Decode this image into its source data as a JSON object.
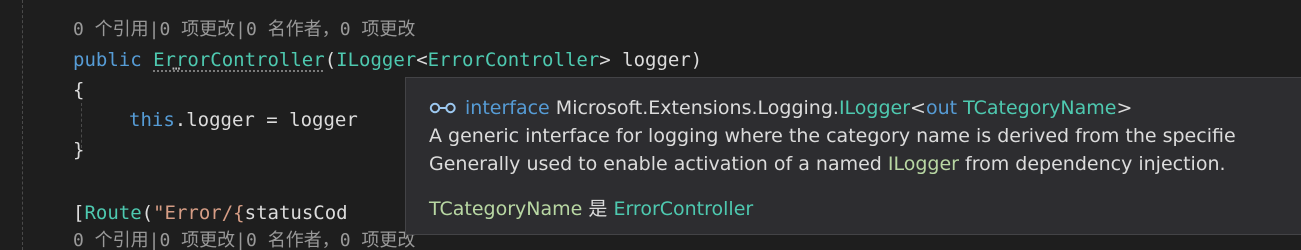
{
  "editor": {
    "codelens_top": "0 个引用|0 项更改|0 名作者，0 项更改",
    "constructor_line": {
      "kw_public": "public",
      "ctor_name": "ErrorController",
      "open_paren": "(",
      "param_type": "ILogger",
      "lt": "<",
      "param_type_arg": "ErrorController",
      "gt": ">",
      "param_name": " logger)"
    },
    "open_brace": "{",
    "assign_line": {
      "kw_this": "this",
      "rest": ".logger = logger"
    },
    "close_brace": "}",
    "route_line": {
      "open": "[",
      "attr": "Route",
      "paren": "(",
      "string": "\"Error/{",
      "rest": "statusCod"
    },
    "codelens_bottom": "0 个引用|0 项更改|0 名作者，0 项更改",
    "dots_glyph": "⋯"
  },
  "tooltip": {
    "kind": "interface",
    "namespace": "Microsoft.Extensions.Logging.",
    "type_name": "ILogger",
    "lt": "<",
    "kw_out": "out",
    "type_param": "TCategoryName",
    "gt": ">",
    "desc1": "A generic interface for logging where the category name is derived from the specifie",
    "desc2_pre": "Generally used to enable activation of a named ",
    "desc2_type": "ILogger",
    "desc2_post": " from dependency injection.",
    "param_name": "TCategoryName",
    "param_is": " 是 ",
    "param_value": "ErrorController",
    "icon": "interface-icon"
  },
  "colors": {
    "background": "#1e1e1e",
    "tooltip_bg": "#2d2d30",
    "keyword": "#569cd6",
    "type": "#4ec9b0",
    "string": "#d69d85",
    "codelens": "#999999"
  }
}
